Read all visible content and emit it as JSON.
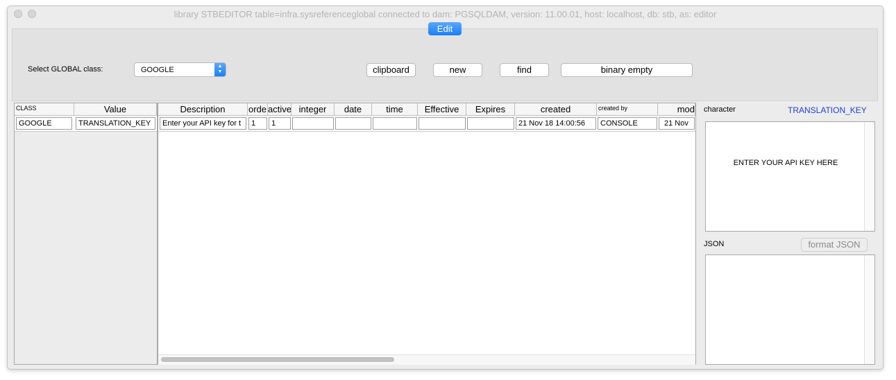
{
  "window": {
    "title": "library STBEDITOR table=infra.sysreferenceglobal connected to dam: PGSQLDAM, version: 11.00.01, host: localhost, db: stb, as: editor"
  },
  "tab": {
    "label": "Edit"
  },
  "controls": {
    "select_label": "Select GLOBAL class:",
    "select_value": "GOOGLE",
    "clipboard": "clipboard",
    "new": "new",
    "find": "find",
    "binary_empty": "binary empty"
  },
  "left_table": {
    "columns": [
      "CLASS",
      "Value"
    ],
    "row": [
      "GOOGLE",
      "TRANSLATION_KEY"
    ]
  },
  "main_table": {
    "columns": [
      "Description",
      "orde",
      "active",
      "integer",
      "date",
      "time",
      "Effective",
      "Expires",
      "created",
      "created by",
      "mod"
    ],
    "row": [
      "Enter your API key for t",
      "1",
      "1",
      "",
      "",
      "",
      "",
      "",
      "21 Nov 18  14:00:56",
      "CONSOLE",
      "21 Nov"
    ]
  },
  "side": {
    "character_label": "character",
    "key_name": "TRANSLATION_KEY",
    "character_value": "ENTER YOUR API KEY HERE",
    "json_label": "JSON",
    "format_json": "format JSON"
  },
  "colors": {
    "accent": "#1b7ff7",
    "link": "#1f3fd6"
  }
}
